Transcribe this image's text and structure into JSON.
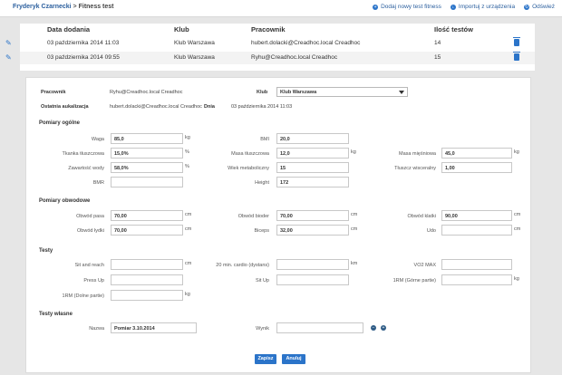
{
  "breadcrumb": {
    "user": "Fryderyk Czarnecki",
    "separator": ">",
    "page": "Fitness test"
  },
  "top_links": {
    "add": "Dodaj nowy test fitness",
    "import": "Importuj z urządzenia",
    "refresh": "Odśwież"
  },
  "list": {
    "headers": {
      "date": "Data dodania",
      "club": "Klub",
      "employee": "Pracownik",
      "count": "Ilość testów"
    },
    "rows": [
      {
        "date": "03 października 2014 11:03",
        "club": "Klub Warszawa",
        "employee": "hubert.dolacki@Creadhoc.local Creadhoc",
        "count": "14"
      },
      {
        "date": "03 października 2014 09:55",
        "club": "Klub Warszawa",
        "employee": "Ryhu@Creadhoc.local Creadhoc",
        "count": "15"
      }
    ]
  },
  "form": {
    "employee_label": "Pracownik",
    "employee_value": "Ryhu@Creadhoc.local Creadhoc",
    "club_label": "Klub",
    "club_value": "Klub Warszawa",
    "last_update_label": "Ostatnia aukalizacja",
    "last_update_value": "hubert.dolacki@Creadhoc.local Creadhoc",
    "day_label": "Dnia",
    "day_value": "03 października 2014 11:03",
    "sections": {
      "general": "Pomiary ogólne",
      "circ": "Pomiary obwodowe",
      "tests": "Testy",
      "own": "Testy własne"
    },
    "general": {
      "waga_label": "Waga",
      "waga_value": "85,0",
      "waga_unit": "kg",
      "bmi_label": "BMI",
      "bmi_value": "20,0",
      "fat_label": "Tkanka tłuszczowa",
      "fat_value": "15,0%",
      "fat_unit": "%",
      "fatmass_label": "Masa tłuszczowa",
      "fatmass_value": "12,0",
      "fatmass_unit": "kg",
      "muscle_label": "Masa mięśniowa",
      "muscle_value": "45,0",
      "muscle_unit": "kg",
      "water_label": "Zawartość wody",
      "water_value": "58,0%",
      "water_unit": "%",
      "age_label": "Wiek metaboliczny",
      "age_value": "15",
      "visc_label": "Tłuszcz wisceralny",
      "visc_value": "1,00",
      "bmr_label": "BMR",
      "bmr_value": "",
      "height_label": "Height",
      "height_value": "172"
    },
    "circ": {
      "waist_label": "Obwód pasa",
      "waist_value": "70,00",
      "waist_unit": "cm",
      "hips_label": "Obwód bioder",
      "hips_value": "70,00",
      "hips_unit": "cm",
      "chest_label": "Obwód klatki",
      "chest_value": "90,00",
      "chest_unit": "cm",
      "calf_label": "Obwód łydki",
      "calf_value": "70,00",
      "calf_unit": "cm",
      "biceps_label": "Biceps",
      "biceps_value": "32,00",
      "biceps_unit": "cm",
      "udo_label": "Udo",
      "udo_value": "",
      "udo_unit": "cm"
    },
    "tests": {
      "sit_label": "Sit and reach",
      "sit_unit": "cm",
      "cardio_label": "20 min. cardio (dystans)",
      "cardio_unit": "km",
      "vo2_label": "VO2 MAX",
      "press_label": "Press Up",
      "situp_label": "Sit Up",
      "rm_upper_label": "1RM (Górne partie)",
      "rm_upper_unit": "kg",
      "rm_lower_label": "1RM (Dolne partie)",
      "rm_lower_unit": "kg"
    },
    "own": {
      "name_label": "Nazwa",
      "name_value": "Pomiar 3.10.2014",
      "result_label": "Wynik",
      "result_value": ""
    },
    "save": "Zapisz",
    "cancel": "Anuluj"
  }
}
